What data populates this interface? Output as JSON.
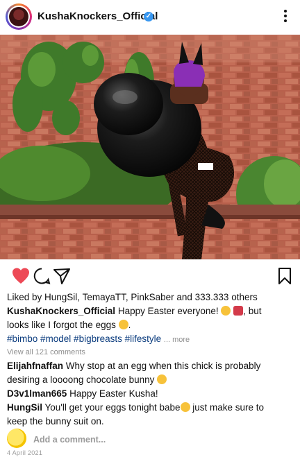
{
  "header": {
    "username": "KushaKnockers_Official",
    "verified_icon": "verified-badge-icon",
    "menu_icon": "more-vertical-icon"
  },
  "post": {
    "likes_text": "Liked by HungSil, TemayaTT, PinkSaber and 333.333 others",
    "caption_user": "KushaKnockers_Official",
    "caption_line1": "Happy Easter everyone!",
    "caption_line1_end": ", but",
    "caption_line2": "looks like I forgot the eggs",
    "hashtags": "#bimbo #model #bigbreasts #lifestyle",
    "more_label": "... more",
    "view_comments": "View all 121 comments",
    "comments": [
      {
        "user": "Elijahfnaffan",
        "text": "Why stop at an egg when this chick is probably",
        "text2": "desiring a loooong chocolate bunny"
      },
      {
        "user": "D3v1lman665",
        "text": "Happy Easter Kusha!"
      },
      {
        "user": "HungSil",
        "text": "You'll get your eggs tonight babe",
        "text_end": "just make sure to",
        "text2": "keep the bunny suit on."
      }
    ],
    "add_comment_placeholder": "Add a comment...",
    "date": "4 April 2021"
  },
  "colors": {
    "like_red": "#ed4956",
    "hashtag_blue": "#0b3c7e",
    "verified_blue": "#3897f0"
  }
}
